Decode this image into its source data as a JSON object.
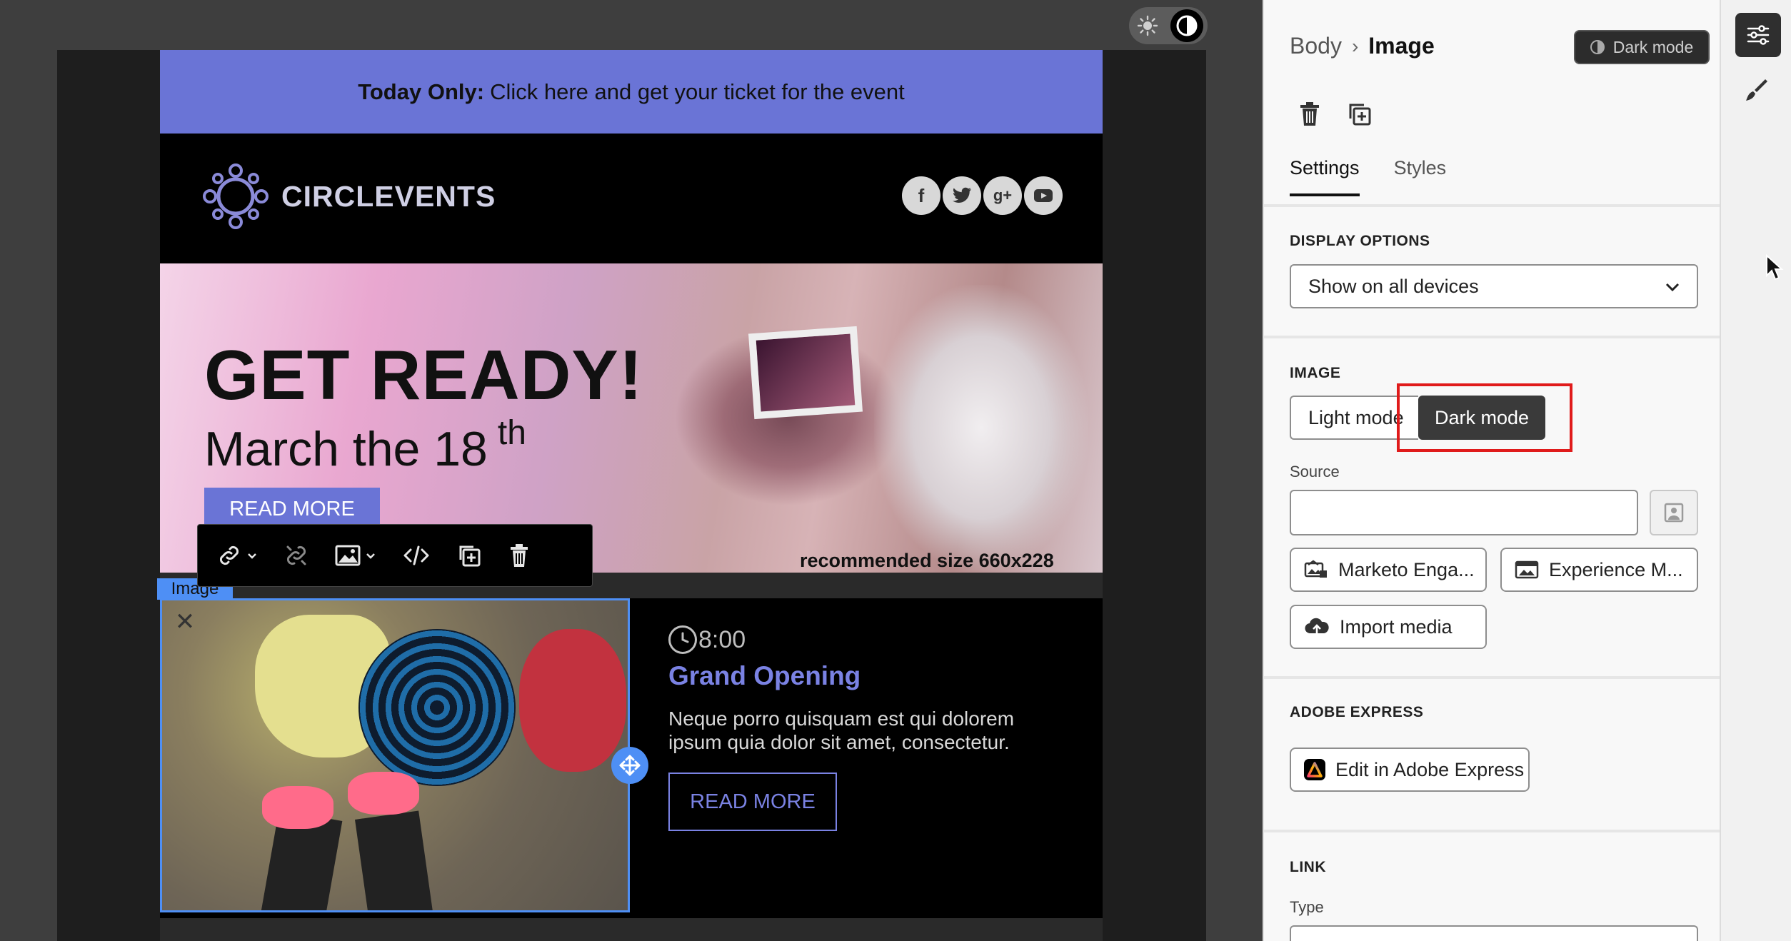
{
  "canvas": {
    "mode_toggle": {
      "sun_icon": "sun-icon",
      "moon_icon": "contrast-icon",
      "active": "dark"
    }
  },
  "email": {
    "banner": {
      "bold": "Today Only:",
      "text": "Click here and get your ticket for the event"
    },
    "logo_text": "CIRCLEVENTS",
    "socials": [
      "f",
      "t",
      "g+",
      "yt"
    ],
    "hero": {
      "title": "GET READY!",
      "subtitle": "March the 18",
      "subtitle_sup": "th",
      "button": "READ MORE",
      "note": "recommended size 660x228"
    },
    "article": {
      "time": "8:00",
      "title": "Grand Opening",
      "text": "Neque porro quisquam est qui dolorem ipsum quia dolor sit amet, consectetur.",
      "button": "READ MORE"
    },
    "image_tag": "Image"
  },
  "toolbar": {
    "items": [
      "link-icon",
      "unlink-icon",
      "image-icon",
      "code-icon",
      "duplicate-icon",
      "trash-icon"
    ]
  },
  "panel": {
    "breadcrumb": {
      "parent": "Body",
      "current": "Image"
    },
    "dark_mode_pill": "Dark mode",
    "tabs": [
      "Settings",
      "Styles"
    ],
    "active_tab": "Settings",
    "display_options": {
      "title": "DISPLAY OPTIONS",
      "value": "Show on all devices"
    },
    "image": {
      "title": "IMAGE",
      "light_mode": "Light mode",
      "dark_mode": "Dark mode",
      "source_label": "Source",
      "source_value": "",
      "marketo_btn": "Marketo Enga...",
      "experience_btn": "Experience M...",
      "import_btn": "Import media"
    },
    "adobe_express": {
      "title": "ADOBE EXPRESS",
      "button": "Edit in Adobe Express"
    },
    "link": {
      "title": "LINK",
      "type_label": "Type"
    }
  },
  "colors": {
    "banner": "#6a74d6",
    "selection": "#4e8ff5",
    "accent_text": "#7a82e3",
    "highlight_box": "#e01b1b"
  }
}
